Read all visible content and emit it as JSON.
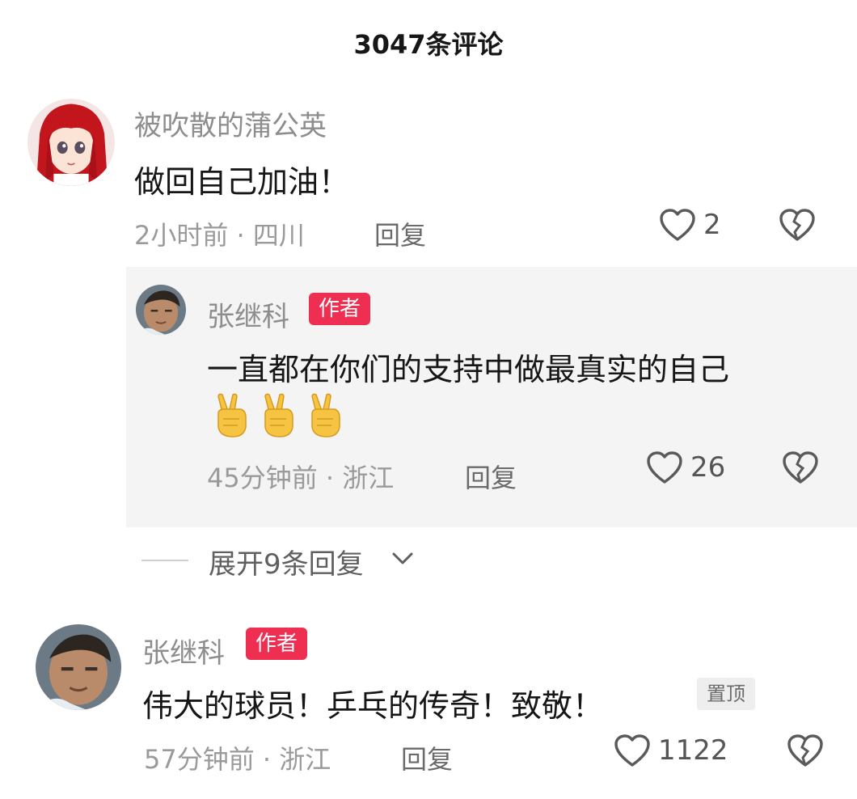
{
  "header": {
    "title": "3047条评论"
  },
  "comments": [
    {
      "username": "被吹散的蒲公英",
      "text": "做回自己加油！",
      "time_location": "2小时前 · 四川",
      "reply_label": "回复",
      "likes": "2"
    },
    {
      "username": "张继科",
      "author_tag": "作者",
      "text": "一直都在你们的支持中做最真实的自己",
      "emoji": "victory-hand x3",
      "time_location": "45分钟前 · 浙江",
      "reply_label": "回复",
      "likes": "26"
    },
    {
      "username": "张继科",
      "author_tag": "作者",
      "text": "伟大的球员！乒乓的传奇！致敬！",
      "pinned_label": "置顶",
      "time_location": "57分钟前 · 浙江",
      "reply_label": "回复",
      "likes": "1122"
    }
  ],
  "expand": {
    "label": "展开9条回复"
  },
  "colors": {
    "author_tag_bg": "#ef2f52",
    "reply_block_bg": "#f4f4f4",
    "meta_text": "#9a9a9a"
  }
}
